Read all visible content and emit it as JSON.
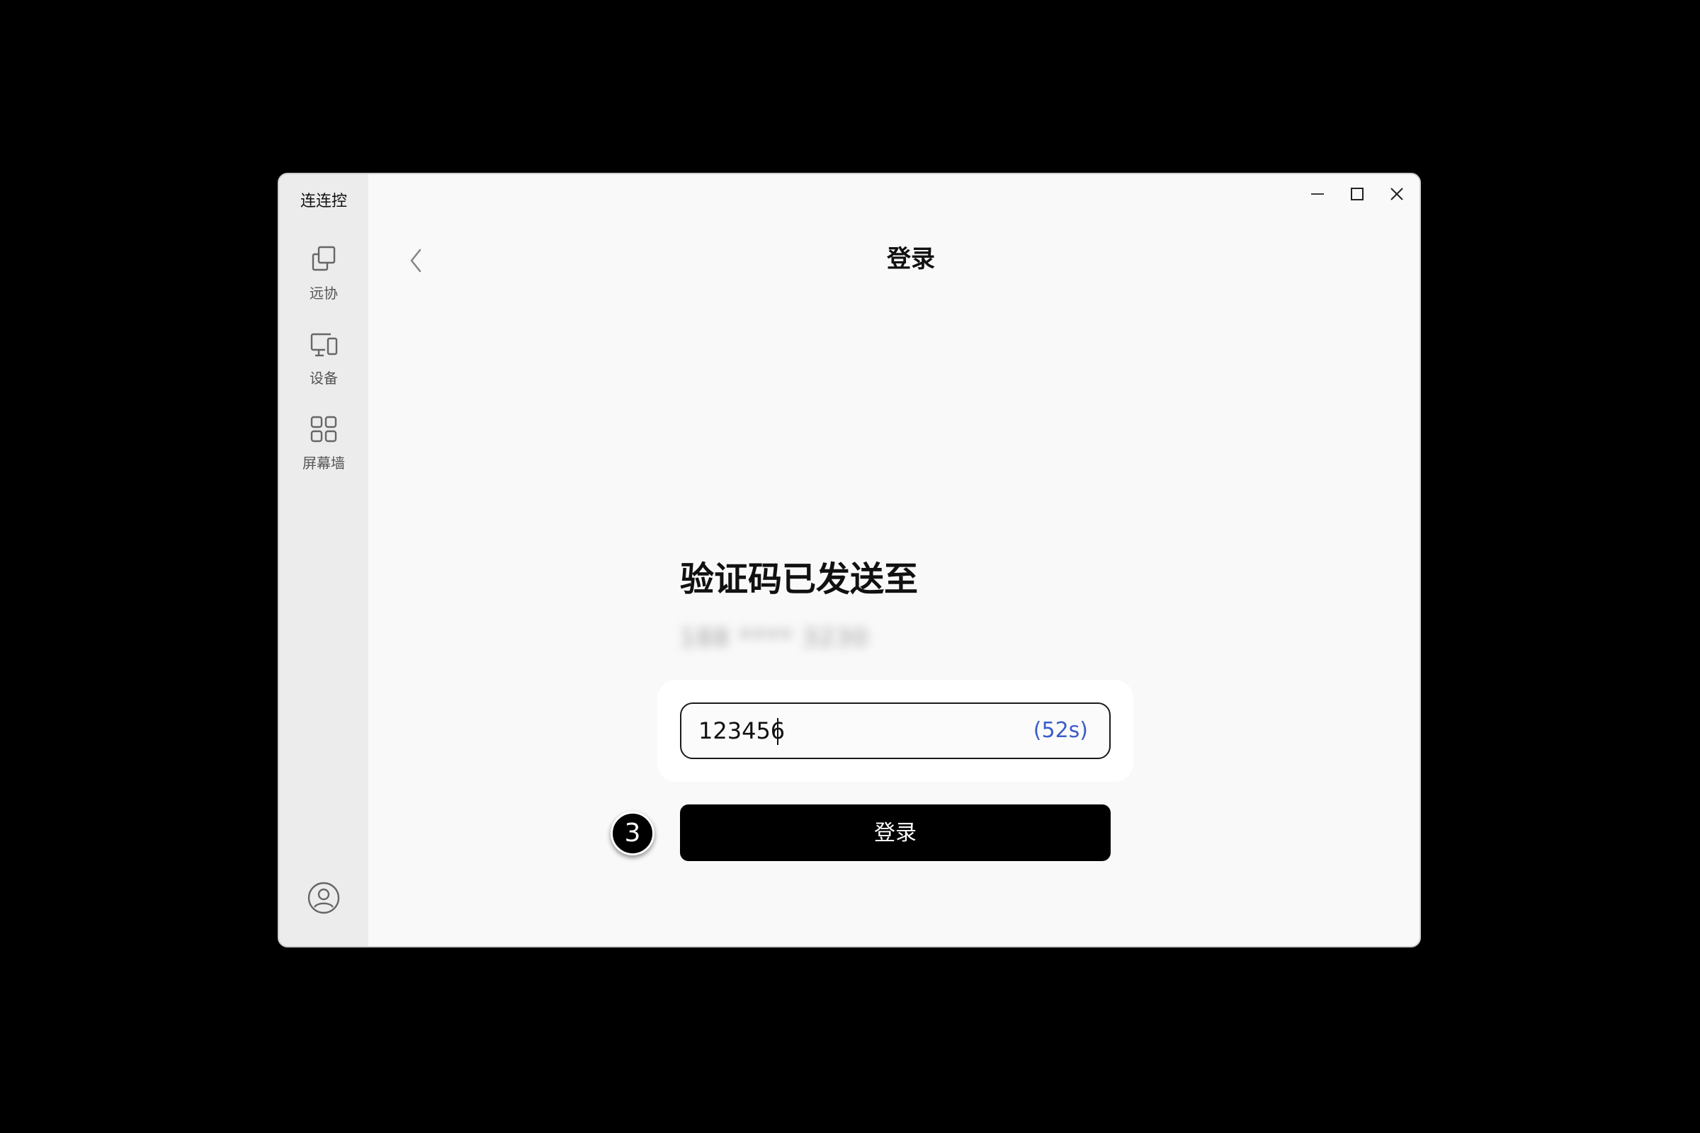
{
  "app": {
    "title": "连连控"
  },
  "sidebar": {
    "items": [
      {
        "label": "远协",
        "icon": "remote-assist-icon"
      },
      {
        "label": "设备",
        "icon": "devices-icon"
      },
      {
        "label": "屏幕墙",
        "icon": "screen-wall-icon"
      }
    ],
    "account_icon": "account-icon"
  },
  "window_controls": [
    "minimize-icon",
    "maximize-icon",
    "close-icon"
  ],
  "header": {
    "back_icon": "chevron-left-icon",
    "title": "登录"
  },
  "main": {
    "heading": "验证码已发送至",
    "phone": "188 **** 3230",
    "code_value": "123456",
    "countdown": "(52s)",
    "login_label": "登录"
  },
  "annotation": {
    "step": "3"
  },
  "colors": {
    "background": "#000000",
    "window": "#f9f9f9",
    "sidebar": "#ececec",
    "accent": "#3a5ccc",
    "primary_button": "#000000"
  }
}
